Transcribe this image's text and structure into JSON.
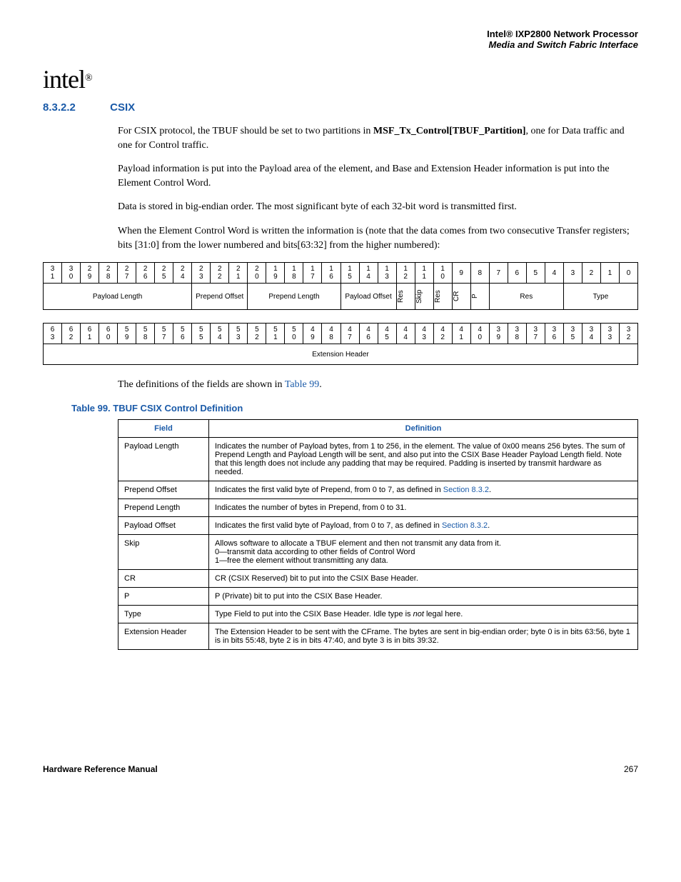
{
  "header": {
    "brand_line": "Intel® IXP2800 Network Processor",
    "title_line": "Media and Switch Fabric Interface",
    "logo_text": "intel",
    "logo_reg": "®"
  },
  "section": {
    "number": "8.3.2.2",
    "title": "CSIX"
  },
  "paragraphs": {
    "p1a": "For CSIX protocol, the TBUF should be set to two partitions in ",
    "p1b": "MSF_Tx_Control[TBUF_Partition]",
    "p1c": ", one for Data traffic and one for Control traffic.",
    "p2": "Payload information is put into the Payload area of the element, and Base and Extension Header information is put into the Element Control Word.",
    "p3": "Data is stored in big-endian order. The most significant byte of each 32-bit word is transmitted first.",
    "p4": "When the Element Control Word is written the information is (note that the data comes from two consecutive Transfer registers; bits [31:0] from the lower numbered and bits[63:32] from the higher numbered):",
    "p5a": "The definitions of the fields are shown in ",
    "p5b": "Table 99",
    "p5c": "."
  },
  "bits1": [
    "31",
    "30",
    "29",
    "28",
    "27",
    "26",
    "25",
    "24",
    "23",
    "22",
    "21",
    "20",
    "19",
    "18",
    "17",
    "16",
    "15",
    "14",
    "13",
    "12",
    "11",
    "10",
    "9",
    "8",
    "7",
    "6",
    "5",
    "4",
    "3",
    "2",
    "1",
    "0"
  ],
  "fields1": {
    "payload_length": "Payload Length",
    "prepend_offset": "Prepend Offset",
    "prepend_length": "Prepend Length",
    "payload_offset": "Payload Offset",
    "res1": "Res",
    "skip": "Skip",
    "res2": "Res",
    "cr": "CR",
    "p": "P",
    "res3": "Res",
    "type": "Type"
  },
  "bits2": [
    "63",
    "62",
    "61",
    "60",
    "59",
    "58",
    "57",
    "56",
    "55",
    "54",
    "53",
    "52",
    "51",
    "50",
    "49",
    "48",
    "47",
    "46",
    "45",
    "44",
    "43",
    "42",
    "41",
    "40",
    "39",
    "38",
    "37",
    "36",
    "35",
    "34",
    "33",
    "32"
  ],
  "fields2": {
    "ext": "Extension Header"
  },
  "table": {
    "caption": "Table 99. TBUF CSIX Control Definition",
    "headers": {
      "field": "Field",
      "definition": "Definition"
    },
    "rows": [
      {
        "f": "Payload Length",
        "d": "Indicates the number of Payload bytes, from 1 to 256, in the element. The value of 0x00 means 256 bytes. The sum of Prepend Length and Payload Length will be sent, and also put into the CSIX Base Header Payload Length field. Note that this length does not include any padding that may be required. Padding is inserted by transmit hardware as needed."
      },
      {
        "f": "Prepend Offset",
        "d": "Indicates the first valid byte of Prepend, from 0 to 7, as defined in ",
        "link": "Section 8.3.2",
        "tail": "."
      },
      {
        "f": "Prepend Length",
        "d": "Indicates the number of bytes in Prepend, from 0 to 31."
      },
      {
        "f": "Payload Offset",
        "d": "Indicates the first valid byte of Payload, from 0 to 7, as defined in ",
        "link": "Section 8.3.2",
        "tail": "."
      },
      {
        "f": "Skip",
        "d": "Allows software to allocate a TBUF element and then not transmit any data from it.\n0—transmit data according to other fields of Control Word\n1—free the element without transmitting any data."
      },
      {
        "f": "CR",
        "d": "CR (CSIX Reserved) bit to put into the CSIX Base Header."
      },
      {
        "f": "P",
        "d": "P (Private) bit to put into the CSIX Base Header."
      },
      {
        "f": "Type",
        "d": "Type Field to put into the CSIX Base Header. Idle type is ",
        "ital": "not",
        "tail": " legal here."
      },
      {
        "f": "Extension Header",
        "d": "The Extension Header to be sent with the CFrame. The bytes are sent in big-endian order; byte 0 is in bits 63:56, byte 1 is in bits 55:48, byte 2 is in bits 47:40, and byte 3 is in bits 39:32."
      }
    ]
  },
  "footer": {
    "left": "Hardware Reference Manual",
    "right": "267"
  }
}
